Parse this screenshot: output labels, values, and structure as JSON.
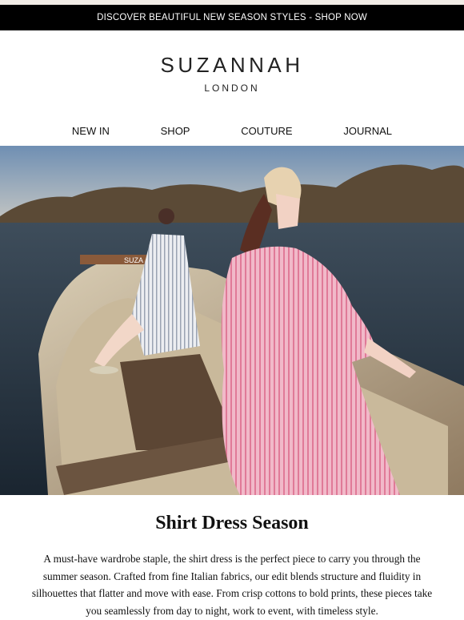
{
  "promo": {
    "text": "DISCOVER BEAUTIFUL NEW SEASON STYLES - SHOP NOW"
  },
  "logo": {
    "brand": "SUZANNAH",
    "city": "LONDON"
  },
  "nav": {
    "items": [
      "NEW IN",
      "SHOP",
      "COUTURE",
      "JOURNAL"
    ]
  },
  "hero": {
    "alt": "Two women in striped shirt dresses sitting in a wooden rowing boat on a river",
    "boat_label": "SUZA"
  },
  "article": {
    "title": "Shirt Dress Season",
    "body": "A must-have wardrobe staple, the shirt dress is the perfect piece to carry you through the summer season. Crafted from fine Italian fabrics, our edit blends structure and fluidity in silhouettes that flatter and move with ease. From crisp cottons to bold prints, these pieces take you seamlessly from day to night, work to event, with timeless style."
  }
}
